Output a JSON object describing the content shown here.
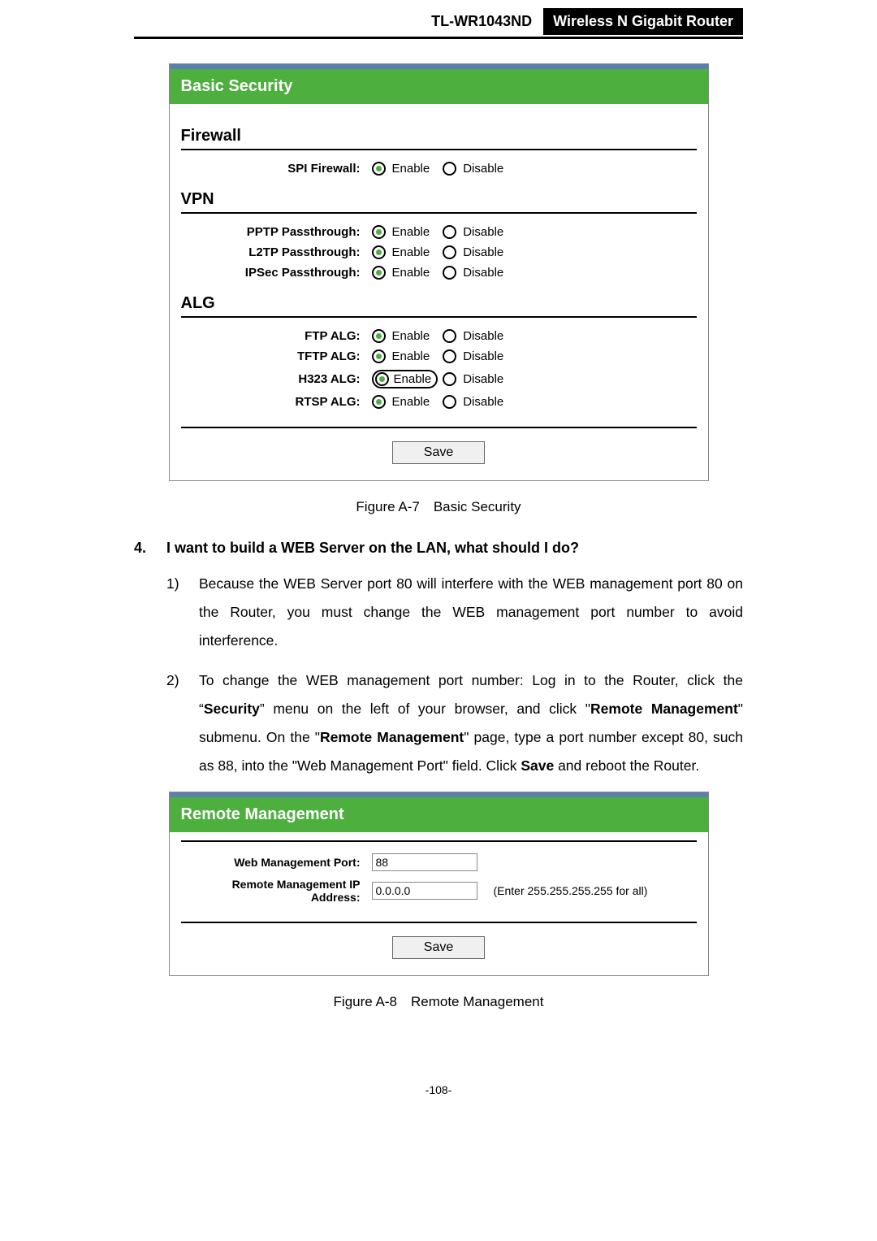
{
  "header": {
    "model": "TL-WR1043ND",
    "title": "Wireless N Gigabit Router"
  },
  "figA7": {
    "panel_title": "Basic Security",
    "sections": {
      "firewall": {
        "title": "Firewall",
        "rows": {
          "spi": {
            "label": "SPI Firewall:",
            "enable": "Enable",
            "disable": "Disable"
          }
        }
      },
      "vpn": {
        "title": "VPN",
        "rows": {
          "pptp": {
            "label": "PPTP Passthrough:",
            "enable": "Enable",
            "disable": "Disable"
          },
          "l2tp": {
            "label": "L2TP Passthrough:",
            "enable": "Enable",
            "disable": "Disable"
          },
          "ipsec": {
            "label": "IPSec Passthrough:",
            "enable": "Enable",
            "disable": "Disable"
          }
        }
      },
      "alg": {
        "title": "ALG",
        "rows": {
          "ftp": {
            "label": "FTP ALG:",
            "enable": "Enable",
            "disable": "Disable"
          },
          "tftp": {
            "label": "TFTP ALG:",
            "enable": "Enable",
            "disable": "Disable"
          },
          "h323": {
            "label": "H323 ALG:",
            "enable": "Enable",
            "disable": "Disable"
          },
          "rtsp": {
            "label": "RTSP ALG:",
            "enable": "Enable",
            "disable": "Disable"
          }
        }
      }
    },
    "save": "Save",
    "caption": "Figure A-7 Basic Security"
  },
  "q4": {
    "num": "4.",
    "text": "I want to build a WEB Server on the LAN, what should I do?",
    "step1": {
      "num": "1)",
      "text": "Because the WEB Server port 80 will interfere with the WEB management port 80 on the Router, you must change the WEB management port number to avoid interference."
    },
    "step2": {
      "num": "2)",
      "pre": "To change the WEB management port number: Log in to the Router, click the “",
      "b1": "Security",
      "mid1": "” menu on the left of your browser, and click \"",
      "b2": "Remote Management",
      "mid2": "\" submenu. On the \"",
      "b3": "Remote Management",
      "mid3": "\" page, type a port number except 80, such as 88, into the \"Web Management Port\" field. Click ",
      "b4": "Save",
      "end": " and reboot the Router."
    }
  },
  "figA8": {
    "panel_title": "Remote Management",
    "port_label": "Web Management Port:",
    "port_value": "88",
    "ip_label": "Remote Management IP Address:",
    "ip_value": "0.0.0.0",
    "ip_hint": "(Enter 255.255.255.255 for all)",
    "save": "Save",
    "caption": "Figure A-8 Remote Management"
  },
  "page_number": "-108-"
}
